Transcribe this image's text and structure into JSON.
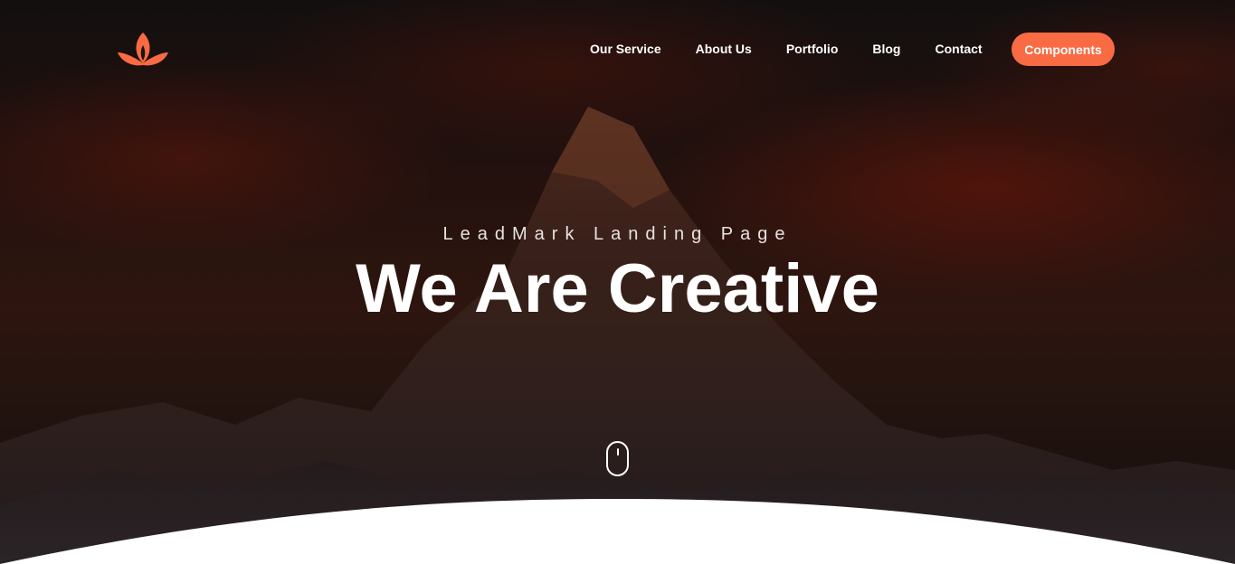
{
  "nav": {
    "links": [
      "Our Service",
      "About Us",
      "Portfolio",
      "Blog",
      "Contact"
    ],
    "cta_label": "Components"
  },
  "hero": {
    "subtitle": "LeadMark Landing Page",
    "title": "We Are Creative"
  },
  "icons": {
    "logo": "lotus-icon",
    "scroll": "mouse-scroll-icon"
  },
  "colors": {
    "accent": "#f96b43",
    "text": "#ffffff",
    "background": "#0e0c0c"
  }
}
